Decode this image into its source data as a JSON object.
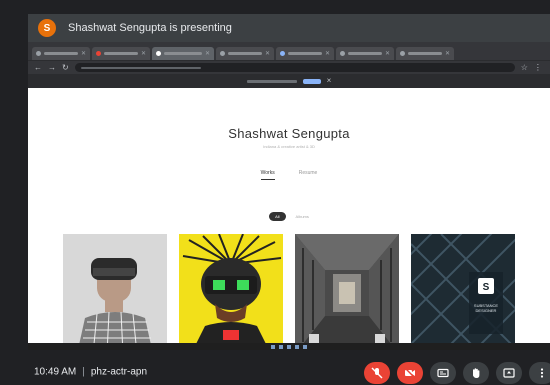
{
  "meeting": {
    "presenter_banner": "Shashwat Sengupta is presenting",
    "time": "10:49 AM",
    "meeting_code": "phz-actr-apn"
  },
  "site": {
    "profile_name": "Shashwat Sengupta",
    "profile_subtitle": "Indiana & creative artist & 3D",
    "tabs": [
      "Works",
      "Resume"
    ],
    "filters": [
      "All",
      "Albums"
    ]
  },
  "gallery": {
    "items": [
      {
        "name": "vr-headset-portrait"
      },
      {
        "name": "cyberpunk-helmet"
      },
      {
        "name": "sci-fi-corridor"
      },
      {
        "name": "substance-designer-art",
        "caption_line1": "SUBSTANCE",
        "caption_line2": "DESIGNER"
      }
    ]
  },
  "colors": {
    "leave_call": "#ea4335",
    "mic_off": "#ea4335",
    "control_dark": "#3c4043",
    "presenter_avatar": "#e8710a"
  }
}
